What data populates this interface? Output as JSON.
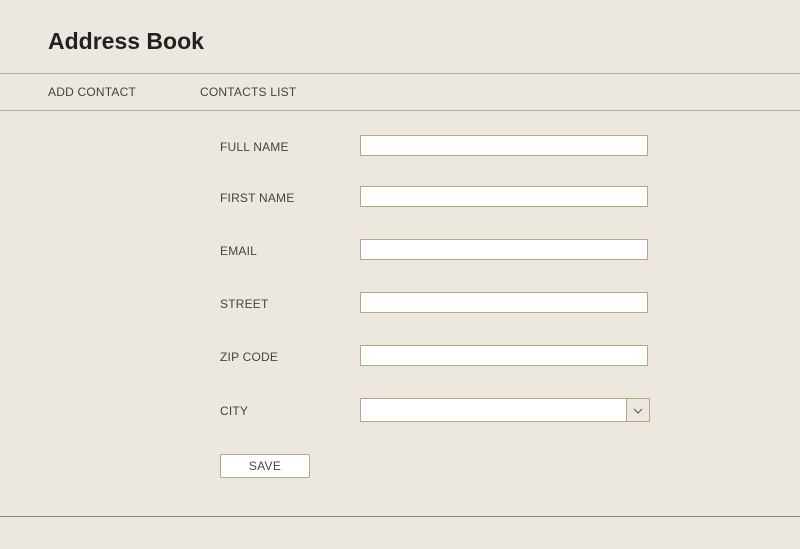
{
  "header": {
    "title": "Address Book"
  },
  "nav": {
    "items": [
      {
        "label": "ADD CONTACT"
      },
      {
        "label": "CONTACTS LIST"
      }
    ]
  },
  "form": {
    "full_name": {
      "label": "FULL NAME",
      "value": ""
    },
    "first_name": {
      "label": "FIRST NAME",
      "value": ""
    },
    "email": {
      "label": "EMAIL",
      "value": ""
    },
    "street": {
      "label": "STREET",
      "value": ""
    },
    "zip_code": {
      "label": "ZIP CODE",
      "value": ""
    },
    "city": {
      "label": "CITY",
      "value": ""
    },
    "save_label": "SAVE"
  },
  "icons": {
    "dropdown": "chevron-down"
  },
  "colors": {
    "background": "#ece8e0",
    "border": "#b5a77f",
    "text": "#444"
  }
}
